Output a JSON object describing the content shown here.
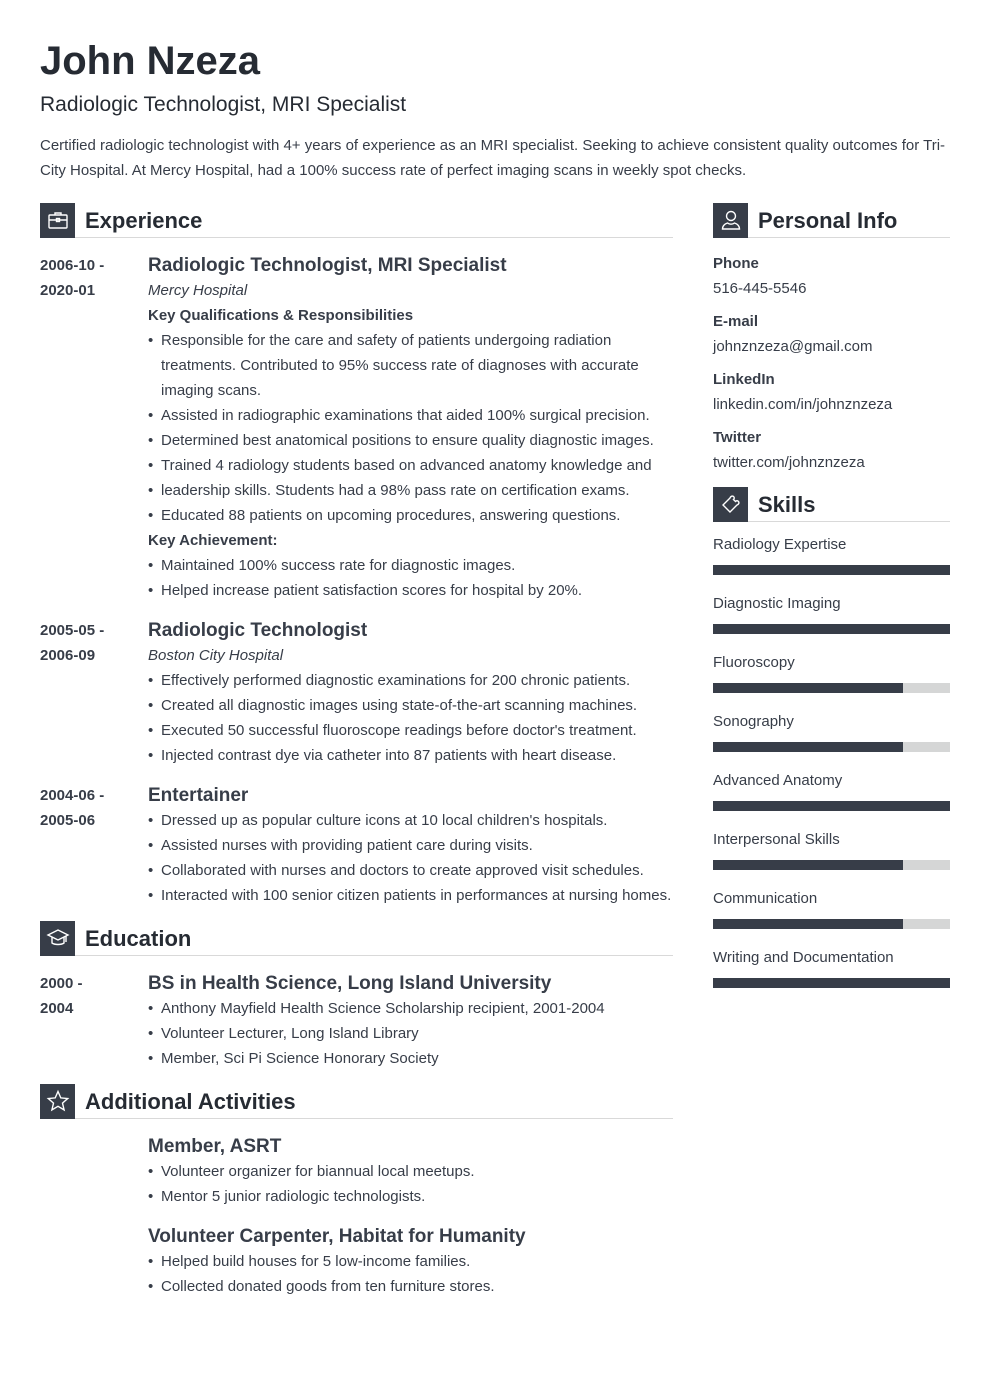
{
  "header": {
    "name": "John Nzeza",
    "title": "Radiologic Technologist, MRI Specialist",
    "summary": "Certified radiologic technologist with 4+ years of experience as an MRI specialist. Seeking to achieve consistent quality outcomes for Tri-City Hospital. At Mercy Hospital, had a 100% success rate of perfect imaging scans in weekly spot checks."
  },
  "sections": {
    "experience": "Experience",
    "education": "Education",
    "activities": "Additional Activities",
    "personal": "Personal Info",
    "skills": "Skills"
  },
  "experience": [
    {
      "date_start": "2006-10 -",
      "date_end": "2020-01",
      "role": "Radiologic Technologist, MRI Specialist",
      "org": "Mercy Hospital",
      "sub1": "Key Qualifications & Responsibilities",
      "bullets1": [
        "Responsible for the care and safety of patients undergoing radiation treatments. Contributed to 95% success rate of diagnoses with accurate imaging scans.",
        "Assisted in radiographic examinations that aided 100% surgical precision.",
        "Determined best anatomical positions to ensure quality diagnostic images.",
        "Trained 4 radiology students based on advanced anatomy knowledge and",
        "leadership skills. Students had a 98% pass rate on certification exams.",
        "Educated 88 patients on upcoming procedures, answering questions."
      ],
      "sub2": "Key Achievement:",
      "bullets2": [
        "Maintained 100% success rate for diagnostic images.",
        "Helped increase patient satisfaction scores for hospital by 20%."
      ]
    },
    {
      "date_start": "2005-05 -",
      "date_end": "2006-09",
      "role": "Radiologic Technologist",
      "org": "Boston City Hospital",
      "bullets": [
        "Effectively performed diagnostic examinations for 200 chronic patients.",
        "Created all diagnostic images using state-of-the-art scanning machines.",
        "Executed 50 successful fluoroscope readings before doctor's treatment.",
        "Injected contrast dye via catheter into 87 patients with heart disease."
      ]
    },
    {
      "date_start": "2004-06 -",
      "date_end": "2005-06",
      "role": "Entertainer",
      "bullets": [
        "Dressed up as popular culture icons at 10 local children's hospitals.",
        "Assisted nurses with providing patient care during visits.",
        "Collaborated with nurses and doctors to create approved visit schedules.",
        "Interacted with 100 senior citizen patients in performances at nursing homes."
      ]
    }
  ],
  "education": [
    {
      "date_start": "2000 -",
      "date_end": "2004",
      "degree": "BS in Health Science, Long Island University",
      "bullets": [
        "Anthony Mayfield Health Science Scholarship recipient, 2001-2004",
        "Volunteer Lecturer, Long Island Library",
        "Member, Sci Pi Science Honorary Society"
      ]
    }
  ],
  "activities": [
    {
      "role": "Member, ASRT",
      "bullets": [
        "Volunteer organizer for biannual local meetups.",
        "Mentor 5 junior radiologic technologists."
      ]
    },
    {
      "role": "Volunteer Carpenter, Habitat for Humanity",
      "bullets": [
        "Helped build houses for 5 low-income families.",
        "Collected donated goods from ten furniture stores."
      ]
    }
  ],
  "personal": [
    {
      "label": "Phone",
      "value": "516-445-5546"
    },
    {
      "label": "E-mail",
      "value": "johnznzeza@gmail.com"
    },
    {
      "label": "LinkedIn",
      "value": "linkedin.com/in/johnznzeza"
    },
    {
      "label": "Twitter",
      "value": "twitter.com/johnznzeza"
    }
  ],
  "skills": [
    {
      "name": "Radiology Expertise",
      "level": 1.0
    },
    {
      "name": "Diagnostic Imaging",
      "level": 1.0
    },
    {
      "name": "Fluoroscopy",
      "level": 0.8
    },
    {
      "name": "Sonography",
      "level": 0.8
    },
    {
      "name": "Advanced Anatomy",
      "level": 1.0
    },
    {
      "name": "Interpersonal Skills",
      "level": 0.8
    },
    {
      "name": "Communication",
      "level": 0.8
    },
    {
      "name": "Writing and Documentation",
      "level": 1.0
    }
  ],
  "colors": {
    "accent": "#373d48",
    "bar_track": "#d5d6d6",
    "divider": "#d9d9d9"
  }
}
